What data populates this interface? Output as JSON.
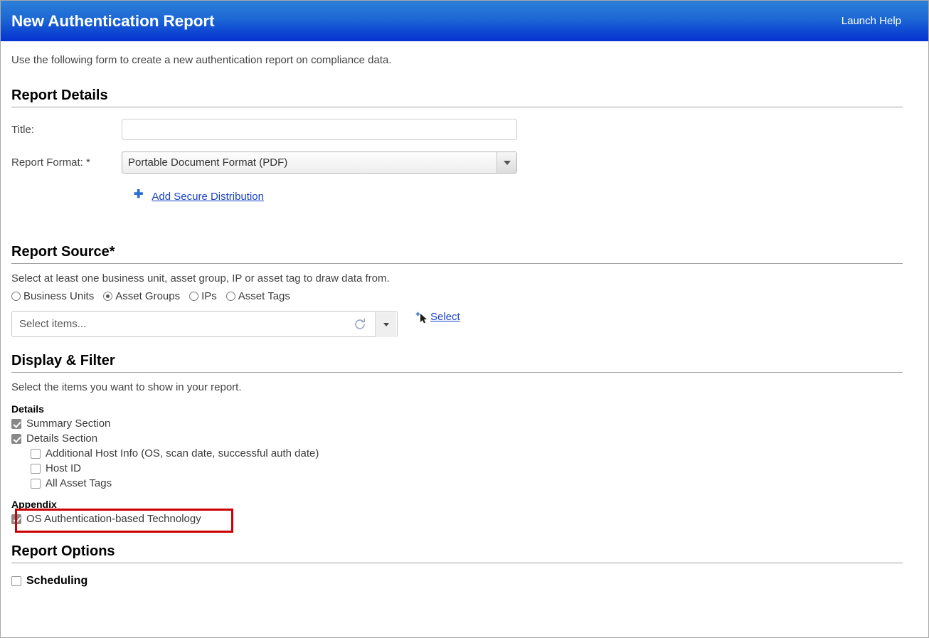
{
  "header": {
    "title": "New Authentication Report",
    "help_link": "Launch Help"
  },
  "intro": "Use the following form to create a new authentication report on compliance data.",
  "report_details": {
    "heading": "Report Details",
    "title_label": "Title:",
    "title_value": "",
    "title_placeholder": "",
    "format_label": "Report Format: *",
    "format_value": "Portable Document Format (PDF)",
    "add_distribution_link": "Add Secure Distribution",
    "plus_icon": "plus-icon"
  },
  "report_source": {
    "heading": "Report Source*",
    "description": "Select at least one business unit, asset group, IP or asset tag to draw data from.",
    "radios": [
      {
        "label": "Business Units",
        "selected": false
      },
      {
        "label": "Asset Groups",
        "selected": true
      },
      {
        "label": "IPs",
        "selected": false
      },
      {
        "label": "Asset Tags",
        "selected": false
      }
    ],
    "items_placeholder": "Select items...",
    "items_value": "",
    "select_link": "Select"
  },
  "display_filter": {
    "heading": "Display & Filter",
    "description": "Select the items you want to show in your report.",
    "details_group_label": "Details",
    "details_items": [
      {
        "label": "Summary Section",
        "checked": true,
        "indent": false
      },
      {
        "label": "Details Section",
        "checked": true,
        "indent": false
      },
      {
        "label": "Additional Host Info (OS, scan date, successful auth date)",
        "checked": false,
        "indent": true
      },
      {
        "label": "Host ID",
        "checked": false,
        "indent": true
      },
      {
        "label": "All Asset Tags",
        "checked": false,
        "indent": true
      }
    ],
    "appendix_group_label": "Appendix",
    "appendix_items": [
      {
        "label": "OS Authentication-based Technology",
        "checked": true
      }
    ],
    "highlight_color": "#cc0000"
  },
  "report_options": {
    "heading": "Report Options",
    "scheduling_label": "Scheduling",
    "scheduling_checked": false
  },
  "colors": {
    "header_top": "#2c7fd8",
    "header_bottom": "#0532cf",
    "link": "#1a44c8",
    "checkbox_fill": "#888888",
    "annotation": "#cc0000"
  }
}
